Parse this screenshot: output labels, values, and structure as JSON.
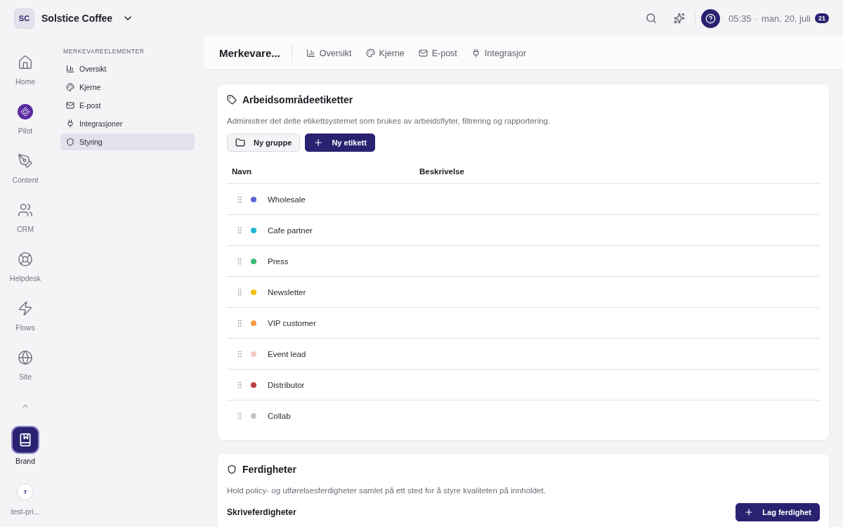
{
  "workspace": {
    "initials": "SC",
    "name": "Solstice Coffee"
  },
  "topbar": {
    "time": "05:35",
    "separator": "·",
    "date": "man. 20. juli",
    "badge": "21"
  },
  "rail": {
    "items": [
      {
        "label": "Home",
        "selected": false
      },
      {
        "label": "Pilot",
        "selected": false
      },
      {
        "label": "Content",
        "selected": false
      },
      {
        "label": "CRM",
        "selected": false
      },
      {
        "label": "Helpdesk",
        "selected": false
      },
      {
        "label": "Flows",
        "selected": false
      },
      {
        "label": "Site",
        "selected": false
      }
    ],
    "pinned": {
      "label": "Brand",
      "selected": true
    },
    "user": {
      "initial": "T",
      "label": "test-pri..."
    }
  },
  "sidebar": {
    "heading": "MERKEVAREELEMENTER",
    "items": [
      {
        "label": "Oversikt",
        "selected": false
      },
      {
        "label": "Kjerne",
        "selected": false
      },
      {
        "label": "E-post",
        "selected": false
      },
      {
        "label": "Integrasjoner",
        "selected": false
      },
      {
        "label": "Styring",
        "selected": true
      }
    ]
  },
  "header": {
    "title": "Merkevare...",
    "tabs": [
      "Oversikt",
      "Kjerne",
      "E-post",
      "Integrasjor"
    ]
  },
  "labels_card": {
    "title": "Arbeidsområdeetiketter",
    "description": "Administrer det delte etikettsystemet som brukes av arbeidsflyter, filtrering og rapportering.",
    "buttons": [
      {
        "label": "Ny gruppe",
        "kind": "secondary"
      },
      {
        "label": "Ny etikett",
        "kind": "primary"
      }
    ],
    "table": {
      "columns": [
        "Navn",
        "Beskrivelse"
      ],
      "rows": [
        {
          "name": "Wholesale",
          "color": "#5b63d9"
        },
        {
          "name": "Cafe partner",
          "color": "#1fb6cf"
        },
        {
          "name": "Press",
          "color": "#3dbb7a"
        },
        {
          "name": "Newsletter",
          "color": "#f2bf0a"
        },
        {
          "name": "VIP customer",
          "color": "#f59a45"
        },
        {
          "name": "Event lead",
          "color": "#f6c5c0"
        },
        {
          "name": "Distributor",
          "color": "#b93f44"
        },
        {
          "name": "Collab",
          "color": "#c2c3c9"
        }
      ]
    }
  },
  "skills_card": {
    "title": "Ferdigheter",
    "description": "Hold policy- og utførelsesferdigheter samlet på ett sted for å styre kvaliteten på innholdet.",
    "subheading": "Skriveferdigheter",
    "button": "Lag ferdighet"
  }
}
